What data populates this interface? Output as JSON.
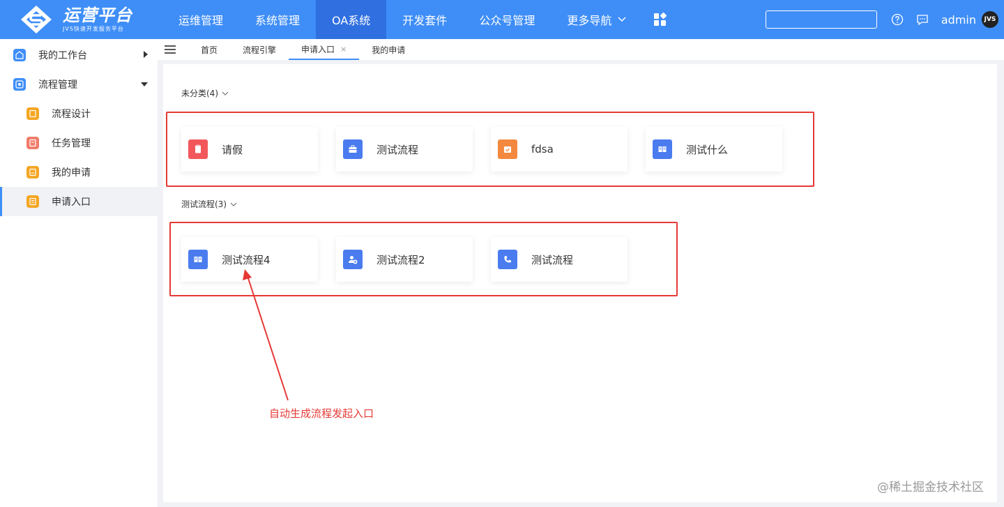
{
  "logo": {
    "title": "运营平台",
    "subtitle": "JVS快速开发服务平台"
  },
  "nav": {
    "items": [
      {
        "label": "运维管理"
      },
      {
        "label": "系统管理"
      },
      {
        "label": "OA系统",
        "active": true
      },
      {
        "label": "开发套件"
      },
      {
        "label": "公众号管理"
      },
      {
        "label": "更多导航"
      }
    ],
    "user": "admin",
    "avatar_text": "JVS"
  },
  "sidebar": {
    "items": [
      {
        "label": "我的工作台",
        "icon": "workbench-icon",
        "color": "#3f8ef7"
      },
      {
        "label": "流程管理",
        "icon": "process-icon",
        "color": "#3f8ef7"
      },
      {
        "label": "流程设计",
        "icon": "design-icon",
        "color": "#f5a623"
      },
      {
        "label": "任务管理",
        "icon": "task-icon",
        "color": "#f07c6a"
      },
      {
        "label": "我的申请",
        "icon": "my-apply-icon",
        "color": "#f5a623"
      },
      {
        "label": "申请入口",
        "icon": "apply-entry-icon",
        "color": "#f5a623",
        "active": true
      }
    ]
  },
  "tabs": [
    {
      "label": "首页"
    },
    {
      "label": "流程引擎"
    },
    {
      "label": "申请入口",
      "active": true,
      "close": "×"
    },
    {
      "label": "我的申请"
    }
  ],
  "groups": [
    {
      "title": "未分类(4)",
      "cards": [
        {
          "label": "请假",
          "icon": "leave-icon",
          "color": "#f2585b"
        },
        {
          "label": "测试流程",
          "icon": "briefcase-icon",
          "color": "#4a7cf0"
        },
        {
          "label": "fdsa",
          "icon": "calendar-check-icon",
          "color": "#f5883f"
        },
        {
          "label": "测试什么",
          "icon": "book-icon",
          "color": "#4a7cf0"
        }
      ]
    },
    {
      "title": "测试流程(3)",
      "cards": [
        {
          "label": "测试流程4",
          "icon": "book-icon",
          "color": "#4a7cf0"
        },
        {
          "label": "测试流程2",
          "icon": "user-add-icon",
          "color": "#4a7cf0"
        },
        {
          "label": "测试流程",
          "icon": "phone-icon",
          "color": "#4a7cf0"
        }
      ]
    }
  ],
  "annotation": "自动生成流程发起入口",
  "watermark": "@稀土掘金技术社区"
}
